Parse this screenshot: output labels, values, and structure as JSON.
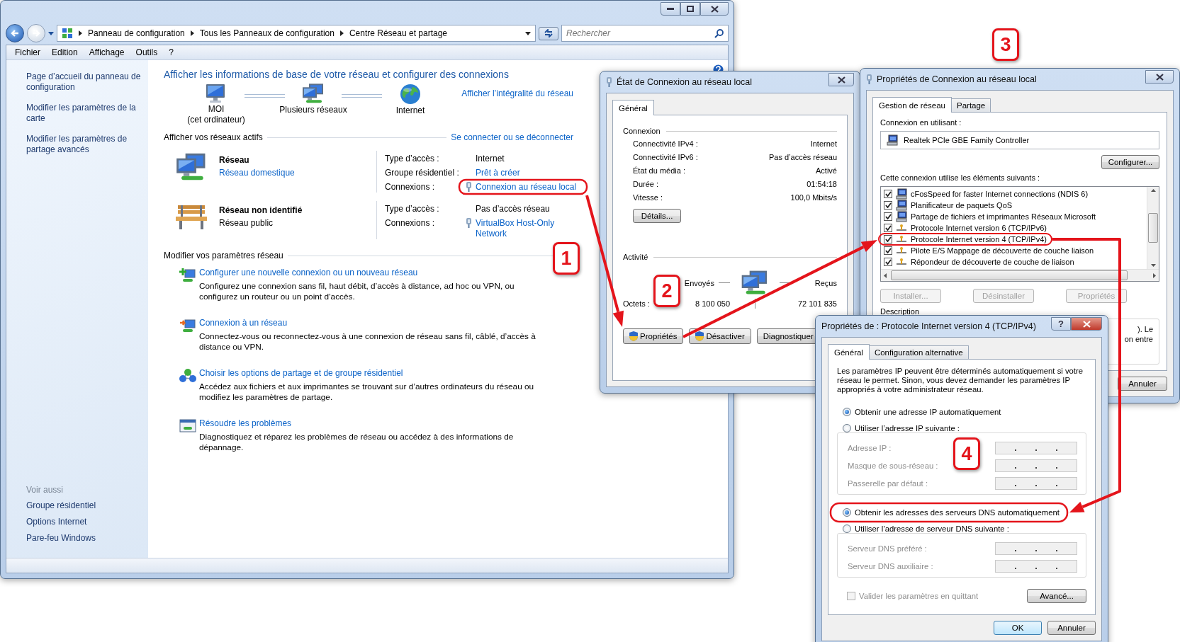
{
  "main_window": {
    "breadcrumbs": [
      "Panneau de configuration",
      "Tous les Panneaux de configuration",
      "Centre Réseau et partage"
    ],
    "search": {
      "placeholder": "Rechercher"
    },
    "menu": [
      "Fichier",
      "Edition",
      "Affichage",
      "Outils",
      "?"
    ],
    "sidebar": {
      "links": [
        "Page d’accueil du panneau de configuration",
        "Modifier les paramètres de la carte",
        "Modifier les paramètres de partage avancés"
      ],
      "see_also_title": "Voir aussi",
      "see_also": [
        "Groupe résidentiel",
        "Options Internet",
        "Pare-feu Windows"
      ]
    },
    "heading": "Afficher les informations de base de votre réseau et configurer des connexions",
    "map": {
      "nodes": [
        {
          "kind": "computer",
          "label": "MOI",
          "sublabel": "(cet ordinateur)"
        },
        {
          "kind": "network",
          "label": "Plusieurs réseaux"
        },
        {
          "kind": "globe",
          "label": "Internet"
        }
      ],
      "link": "Afficher l’intégralité du réseau"
    },
    "active_networks": {
      "title": "Afficher vos réseaux actifs",
      "link": "Se connecter ou se déconnecter",
      "networks": [
        {
          "kind": "home",
          "name": "Réseau",
          "category": "Réseau domestique",
          "category_link": true,
          "details": [
            {
              "label": "Type d’accès :",
              "value": "Internet",
              "link": false
            },
            {
              "label": "Groupe résidentiel :",
              "value": "Prêt à créer",
              "link": true
            },
            {
              "label": "Connexions :",
              "value": "Connexion au réseau local",
              "link": true,
              "icon": true
            }
          ]
        },
        {
          "kind": "public",
          "name": "Réseau non identifié",
          "category": "Réseau public",
          "category_link": false,
          "details": [
            {
              "label": "Type d’accès :",
              "value": "Pas d’accès réseau",
              "link": false
            },
            {
              "label": "Connexions :",
              "value": "VirtualBox Host-Only Network",
              "link": true,
              "icon": true
            }
          ]
        }
      ]
    },
    "settings": {
      "title": "Modifier vos paramètres réseau",
      "tasks": [
        {
          "kind": "new",
          "title": "Configurer une nouvelle connexion ou un nouveau réseau",
          "description": "Configurez une connexion sans fil, haut débit, d’accès à distance, ad hoc ou VPN, ou configurez un routeur ou un point d’accès."
        },
        {
          "kind": "connect",
          "title": "Connexion à un réseau",
          "description": "Connectez-vous ou reconnectez-vous à une connexion de réseau sans fil, câblé, d’accès à distance ou VPN."
        },
        {
          "kind": "share",
          "title": "Choisir les options de partage et de groupe résidentiel",
          "description": "Accédez aux fichiers et aux imprimantes se trouvant sur d’autres ordinateurs du réseau ou modifiez les paramètres de partage."
        },
        {
          "kind": "repair",
          "title": "Résoudre les problèmes",
          "description": "Diagnostiquez et réparez les problèmes de réseau ou accédez à des informations de dépannage."
        }
      ]
    }
  },
  "status_dialog": {
    "title": "État de Connexion au réseau local",
    "tabs": [
      {
        "label": "Général",
        "selected": true
      }
    ],
    "connection": {
      "title": "Connexion",
      "rows": [
        {
          "label": "Connectivité IPv4 :",
          "value": "Internet"
        },
        {
          "label": "Connectivité IPv6 :",
          "value": "Pas d’accès réseau"
        },
        {
          "label": "État du média :",
          "value": "Activé"
        },
        {
          "label": "Durée :",
          "value": "01:54:18"
        },
        {
          "label": "Vitesse :",
          "value": "100,0 Mbits/s"
        }
      ]
    },
    "details_button": "Détails...",
    "activity": {
      "title": "Activité",
      "sent_label": "Envoyés",
      "received_label": "Reçus",
      "bytes_label": "Octets :",
      "sent": "8 100 050",
      "received": "72 101 835"
    },
    "buttons": [
      "Propriétés",
      "Désactiver",
      "Diagnostiquer"
    ]
  },
  "properties_dialog": {
    "title": "Propriétés de Connexion au réseau local",
    "tabs": [
      {
        "label": "Gestion de réseau",
        "selected": true
      },
      {
        "label": "Partage",
        "selected": false
      }
    ],
    "connect_using_label": "Connexion en utilisant :",
    "adapter": "Realtek PCIe GBE Family Controller",
    "configure_button": "Configurer...",
    "items_label": "Cette connexion utilise les éléments suivants :",
    "items": [
      {
        "kind": "service",
        "label": "cFosSpeed for faster Internet connections (NDIS 6)",
        "checked": true
      },
      {
        "kind": "service",
        "label": "Planificateur de paquets QoS",
        "checked": true
      },
      {
        "kind": "service",
        "label": "Partage de fichiers et imprimantes Réseaux Microsoft",
        "checked": true
      },
      {
        "kind": "protocol",
        "label": "Protocole Internet version 6 (TCP/IPv6)",
        "checked": true
      },
      {
        "kind": "protocol",
        "label": "Protocole Internet version 4 (TCP/IPv4)",
        "checked": true
      },
      {
        "kind": "protocol",
        "label": "Pilote E/S Mappage de découverte de couche liaison",
        "checked": true
      },
      {
        "kind": "protocol",
        "label": "Répondeur de découverte de couche de liaison",
        "checked": true
      }
    ],
    "item_buttons": [
      {
        "label": "Installer...",
        "disabled": true
      },
      {
        "label": "Désinstaller",
        "disabled": true
      },
      {
        "label": "Propriétés",
        "disabled": true
      }
    ],
    "description_title": "Description",
    "description_fragments": [
      "). Le",
      "on entre"
    ],
    "cancel_button": "Annuler"
  },
  "ipv4_dialog": {
    "title": "Propriétés de : Protocole Internet version 4 (TCP/IPv4)",
    "help_button": "?",
    "tabs": [
      {
        "label": "Général",
        "selected": true
      },
      {
        "label": "Configuration alternative",
        "selected": false
      }
    ],
    "intro": "Les paramètres IP peuvent être déterminés automatiquement si votre réseau le permet. Sinon, vous devez demander les paramètres IP appropriés à votre administrateur réseau.",
    "ip_options": [
      {
        "label": "Obtenir une adresse IP automatiquement",
        "selected": true
      },
      {
        "label": "Utiliser l’adresse IP suivante :",
        "selected": false
      }
    ],
    "ip_fields": [
      {
        "label": "Adresse IP :",
        "disabled": true
      },
      {
        "label": "Masque de sous-réseau :",
        "disabled": true
      },
      {
        "label": "Passerelle par défaut :",
        "disabled": true
      }
    ],
    "dns_options": [
      {
        "label": "Obtenir les adresses des serveurs DNS automatiquement",
        "selected": true
      },
      {
        "label": "Utiliser l’adresse de serveur DNS suivante :",
        "selected": false
      }
    ],
    "dns_fields": [
      {
        "label": "Serveur DNS préféré :",
        "disabled": true
      },
      {
        "label": "Serveur DNS auxiliaire :",
        "disabled": true
      }
    ],
    "validate": {
      "label": "Valider les paramètres en quittant",
      "checked": false,
      "disabled": true
    },
    "advanced_button": "Avancé...",
    "ok_button": "OK",
    "cancel_button": "Annuler"
  },
  "annotations": {
    "steps": [
      "1",
      "2",
      "3",
      "4"
    ]
  }
}
